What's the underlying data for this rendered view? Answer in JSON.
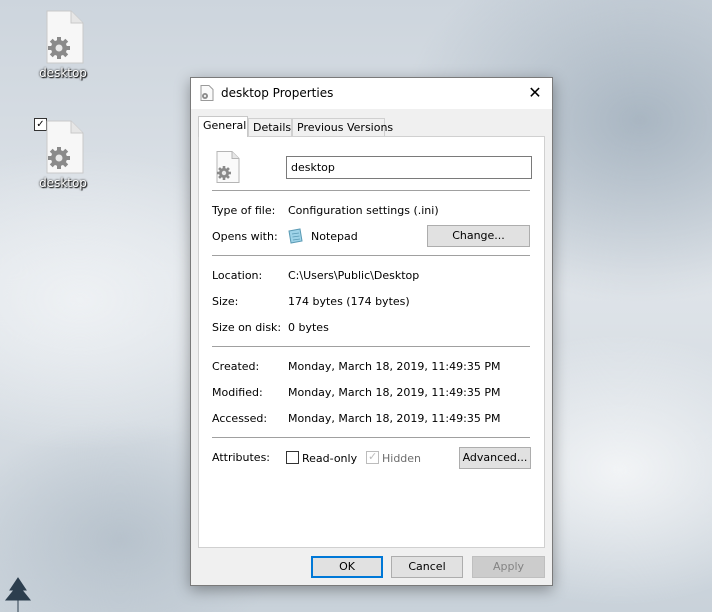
{
  "desktop": {
    "icons": [
      {
        "label": "desktop"
      },
      {
        "label": "desktop"
      }
    ]
  },
  "window": {
    "title": "desktop Properties",
    "close_symbol": "✕",
    "tabs": [
      {
        "label": "General",
        "active": true
      },
      {
        "label": "Details",
        "active": false
      },
      {
        "label": "Previous Versions",
        "active": false
      }
    ],
    "general": {
      "file_name": "desktop",
      "type_of_file_label": "Type of file:",
      "type_of_file_value": "Configuration settings (.ini)",
      "opens_with_label": "Opens with:",
      "opens_with_value": "Notepad",
      "change_button": "Change...",
      "location_label": "Location:",
      "location_value": "C:\\Users\\Public\\Desktop",
      "size_label": "Size:",
      "size_value": "174 bytes (174 bytes)",
      "size_on_disk_label": "Size on disk:",
      "size_on_disk_value": "0 bytes",
      "created_label": "Created:",
      "created_value": "Monday, March 18, 2019, 11:49:35 PM",
      "modified_label": "Modified:",
      "modified_value": "Monday, March 18, 2019, 11:49:35 PM",
      "accessed_label": "Accessed:",
      "accessed_value": "Monday, March 18, 2019, 11:49:35 PM",
      "attributes_label": "Attributes:",
      "readonly_label": "Read-only",
      "readonly_checked": false,
      "hidden_label": "Hidden",
      "hidden_checked": true,
      "advanced_button": "Advanced..."
    },
    "footer": {
      "ok": "OK",
      "cancel": "Cancel",
      "apply": "Apply"
    }
  },
  "colors": {
    "accent": "#0078d7",
    "window_bg": "#f0f0f0",
    "panel_bg": "#ffffff"
  },
  "icons": {
    "file": "settings-file-icon",
    "notepad": "notepad-icon",
    "close": "close-icon",
    "check": "checkmark-icon"
  }
}
